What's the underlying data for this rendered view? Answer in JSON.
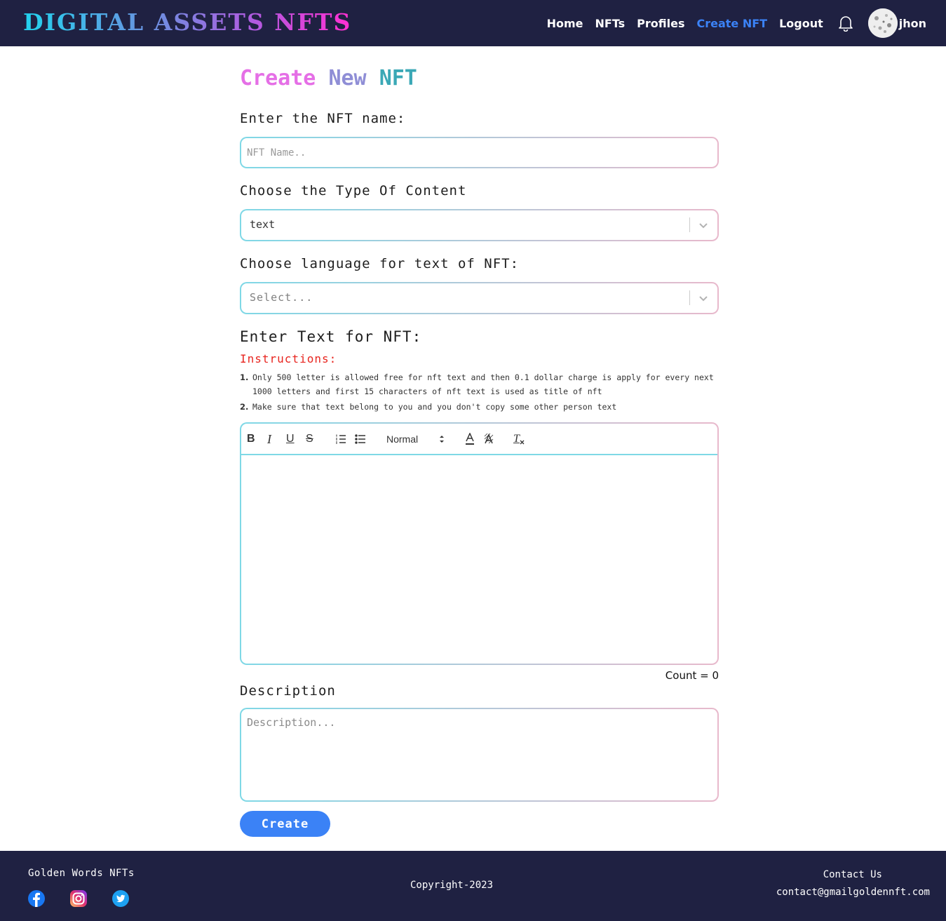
{
  "header": {
    "brand": "DIGITAL ASSETS NFTS",
    "nav": [
      {
        "label": "Home"
      },
      {
        "label": "NFTs"
      },
      {
        "label": "Profiles"
      },
      {
        "label": "Create NFT",
        "active": true
      },
      {
        "label": "Logout"
      }
    ],
    "user_name": "jhon",
    "icons": [
      "bell-icon",
      "avatar"
    ]
  },
  "main": {
    "title": [
      "Create",
      "New",
      "NFT"
    ],
    "name_label": "Enter the NFT name:",
    "name_placeholder": "NFT Name..",
    "type_label": "Choose the Type Of Content",
    "type_value": "text",
    "lang_label": "Choose language for text of NFT:",
    "lang_placeholder": "Select...",
    "text_label": "Enter Text for NFT:",
    "instructions_title": "Instructions:",
    "instructions": [
      {
        "num": "1.",
        "text": "Only 500 letter is allowed free for nft text and then 0.1 dollar charge is apply for every next 1000 letters and first 15 characters of nft text is used as title of nft"
      },
      {
        "num": "2.",
        "text": "Make sure that text belong to you and you don't copy some other person text"
      }
    ],
    "editor_toolbar": {
      "bold": "B",
      "italic": "I",
      "underline": "U",
      "strike": "S",
      "header_value": "Normal",
      "clean": "T"
    },
    "count_label": "Count = 0",
    "description_label": "Description",
    "description_placeholder": "Description...",
    "create_button": "Create"
  },
  "footer": {
    "brand": "Golden Words NFTs",
    "socials": [
      "facebook-icon",
      "instagram-icon",
      "twitter-icon"
    ],
    "copyright": "Copyright-2023",
    "contact_title": "Contact Us",
    "contact_email": "contact@gmailgoldennft.com"
  },
  "colors": {
    "navbar_bg": "#1f2142",
    "accent": "#3b82f6",
    "instructions": "#e8251f"
  }
}
